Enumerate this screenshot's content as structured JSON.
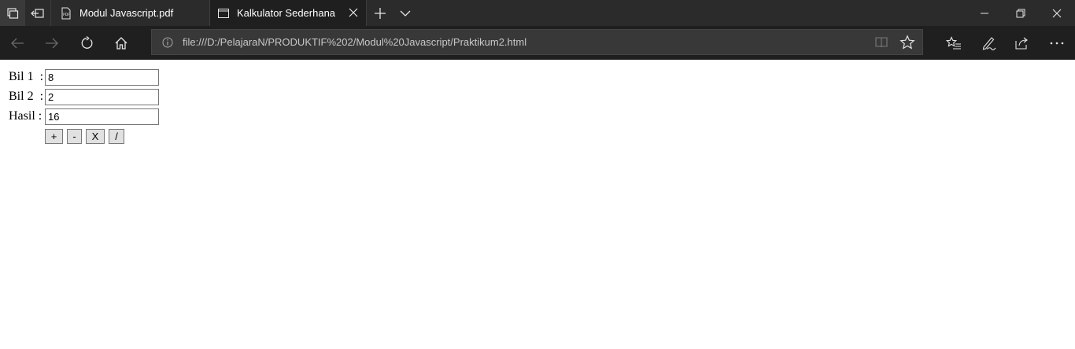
{
  "browser": {
    "tabs": [
      {
        "label": "Modul Javascript.pdf",
        "active": false,
        "icon": "pdf-icon"
      },
      {
        "label": "Kalkulator Sederhana",
        "active": true,
        "icon": "page-icon"
      }
    ],
    "address": "file:///D:/PelajaraN/PRODUKTIF%202/Modul%20Javascript/Praktikum2.html",
    "theme": {
      "tabstrip": "#2b2b2b",
      "toolbar": "#1f1f1f",
      "addressbar": "#383838",
      "icon": "#e6e6e6"
    }
  },
  "form": {
    "bil1": {
      "label": "Bil 1  :",
      "value": "8"
    },
    "bil2": {
      "label": "Bil 2  :",
      "value": "2"
    },
    "hasil": {
      "label": "Hasil :",
      "value": "16"
    },
    "buttons": {
      "add": "+",
      "subtract": "-",
      "multiply": "X",
      "divide": "/"
    }
  }
}
